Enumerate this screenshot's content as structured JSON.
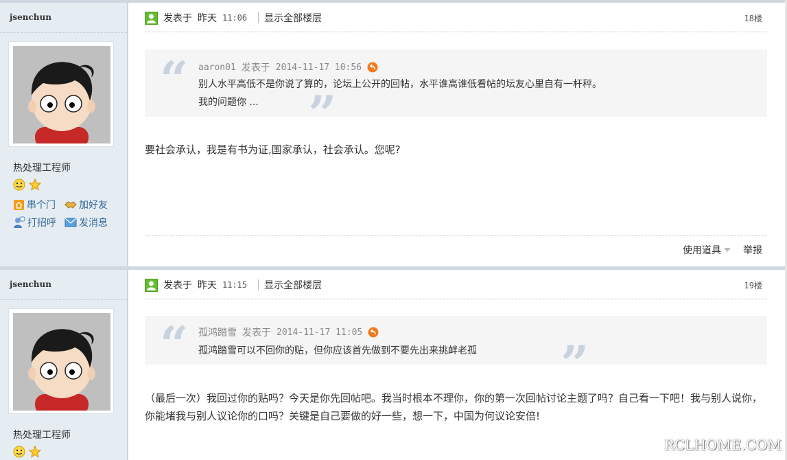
{
  "posts": [
    {
      "username": "jsenchun",
      "rank": "热处理工程师",
      "actions": {
        "visit": "串个门",
        "add_friend": "加好友",
        "greet": "打招呼",
        "message": "发消息"
      },
      "posted_label": "发表于",
      "posted_day": "昨天",
      "posted_time": "11:06",
      "show_all": "显示全部楼层",
      "floor": "18楼",
      "quote": {
        "author": "aaron01",
        "posted_label": "发表于",
        "timestamp": "2014-11-17 10:56",
        "lines": [
          "别人水平高低不是你说了算的，论坛上公开的回帖，水平谁高谁低看帖的坛友心里自有一杆秤。",
          "我的问题你 ..."
        ]
      },
      "body": "要社会承认，我是有书为证,国家承认，社会承认。您呢?",
      "footer": {
        "tools": "使用道具",
        "report": "举报"
      }
    },
    {
      "username": "jsenchun",
      "rank": "热处理工程师",
      "posted_label": "发表于",
      "posted_day": "昨天",
      "posted_time": "11:15",
      "show_all": "显示全部楼层",
      "floor": "19楼",
      "quote": {
        "author": "孤鸿踏雪",
        "posted_label": "发表于",
        "timestamp": "2014-11-17 11:05",
        "lines": [
          "孤鸿踏雪可以不回你的贴，但你应该首先做到不要先出来挑衅老孤"
        ]
      },
      "body": "（最后一次）我回过你的贴吗？今天是你先回帖吧。我当时根本不理你，你的第一次回帖讨论主题了吗？自己看一下吧！我与别人说你，你能堵我与别人议论你的口吗？关键是自己要做的好一些，想一下，中国为何议论安倍!"
    }
  ],
  "watermark": "RCLHOME.COM"
}
